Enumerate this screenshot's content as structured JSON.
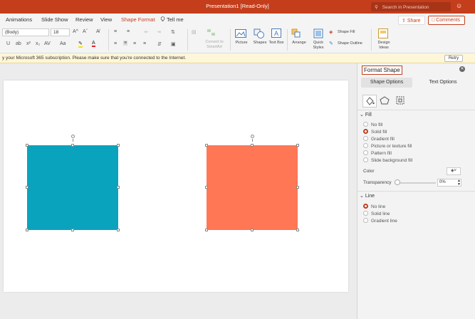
{
  "titlebar": {
    "title": "Presentation1 [Read-Only]",
    "search_placeholder": "Search in Presentation",
    "search_icon": "magnifier-icon",
    "user_icon": "person-icon"
  },
  "tabs": [
    {
      "label": "Animations"
    },
    {
      "label": "Slide Show"
    },
    {
      "label": "Review"
    },
    {
      "label": "View"
    },
    {
      "label": "Shape Format",
      "active": true
    },
    {
      "label": "Tell me",
      "icon": "lightbulb-icon"
    }
  ],
  "actions": {
    "share_label": "Share",
    "comments_label": "Comments"
  },
  "ribbon": {
    "font_name": "(Body)",
    "font_size": "18",
    "convert_label": "Convert to SmartArt",
    "picture_label": "Picture",
    "shapes_label": "Shapes",
    "textbox_label": "Text Box",
    "arrange_label": "Arrange",
    "quick_styles_label": "Quick Styles",
    "shape_fill_label": "Shape Fill",
    "shape_outline_label": "Shape Outline",
    "design_ideas_label": "Design Ideas"
  },
  "message_bar": {
    "text": "y your Microsoft 365 subscription. Please make sure that you're connected to the Internet.",
    "retry_label": "Retry"
  },
  "slide": {
    "shapes": [
      {
        "name": "teal-rectangle",
        "color": "#0aa3bd"
      },
      {
        "name": "coral-rectangle",
        "color": "#ff7755"
      }
    ]
  },
  "format_pane": {
    "title": "Format Shape",
    "tabs": [
      {
        "label": "Shape Options",
        "active": true
      },
      {
        "label": "Text Options",
        "active": false
      }
    ],
    "icons": [
      "fill-bucket-icon",
      "pentagon-icon",
      "size-properties-icon"
    ],
    "fill": {
      "header": "Fill",
      "options": [
        {
          "label": "No fill",
          "checked": false
        },
        {
          "label": "Solid fill",
          "checked": true
        },
        {
          "label": "Gradient fill",
          "checked": false
        },
        {
          "label": "Picture or texture fill",
          "checked": false
        },
        {
          "label": "Pattern fill",
          "checked": false
        },
        {
          "label": "Slide background fill",
          "checked": false
        }
      ],
      "color_label": "Color",
      "transparency_label": "Transparency",
      "transparency_value": "0%"
    },
    "line": {
      "header": "Line",
      "options": [
        {
          "label": "No line",
          "checked": true
        },
        {
          "label": "Solid line",
          "checked": false
        },
        {
          "label": "Gradient line",
          "checked": false
        }
      ]
    }
  },
  "colors": {
    "accent": "#c43e1c",
    "teal": "#0aa3bd",
    "coral": "#ff7755"
  }
}
